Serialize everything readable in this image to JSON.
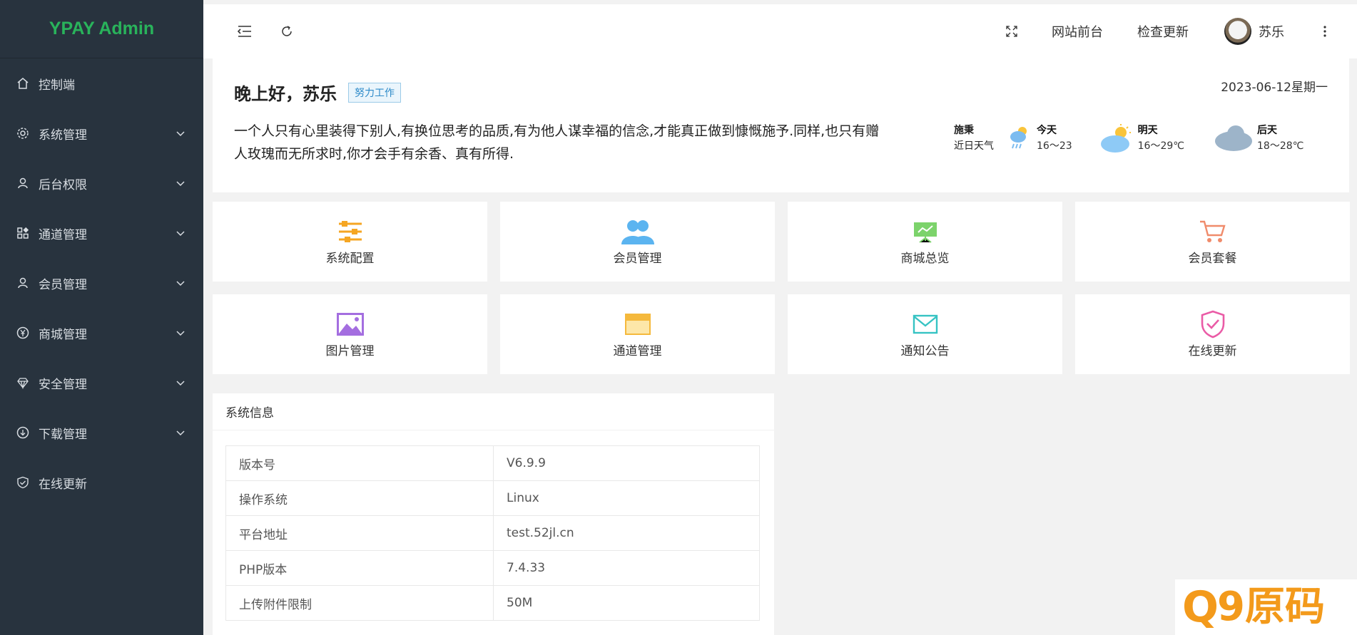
{
  "app": {
    "logo": "YPAY Admin"
  },
  "sidebar": {
    "items": [
      {
        "label": "控制端",
        "icon": "home-icon",
        "has_arrow": false
      },
      {
        "label": "系统管理",
        "icon": "gear-icon",
        "has_arrow": true
      },
      {
        "label": "后台权限",
        "icon": "user-icon",
        "has_arrow": true
      },
      {
        "label": "通道管理",
        "icon": "apps-icon",
        "has_arrow": true
      },
      {
        "label": "会员管理",
        "icon": "user-icon",
        "has_arrow": true
      },
      {
        "label": "商城管理",
        "icon": "yen-icon",
        "has_arrow": true
      },
      {
        "label": "安全管理",
        "icon": "diamond-icon",
        "has_arrow": true
      },
      {
        "label": "下载管理",
        "icon": "download-icon",
        "has_arrow": true
      },
      {
        "label": "在线更新",
        "icon": "shield-check-icon",
        "has_arrow": false
      }
    ]
  },
  "header": {
    "frontend_link": "网站前台",
    "check_update": "检查更新",
    "username": "苏乐"
  },
  "welcome": {
    "greeting": "晚上好，苏乐",
    "badge": "努力工作",
    "date": "2023-06-12星期一",
    "quote": "一个人只有心里装得下别人,有换位思考的品质,有为他人谋幸福的信念,才能真正做到慷慨施予.同样,也只有赠人玫瑰而无所求时,你才会手有余香、真有所得."
  },
  "weather": {
    "city": "施秉",
    "caption": "近日天气",
    "days": [
      {
        "label": "今天",
        "temp": "16～23",
        "icon": "rain-cloud-icon"
      },
      {
        "label": "明天",
        "temp": "16～29℃",
        "icon": "sun-cloud-icon"
      },
      {
        "label": "后天",
        "temp": "18～28℃",
        "icon": "cloud-icon"
      }
    ]
  },
  "quick": [
    {
      "label": "系统配置",
      "icon": "sliders-icon",
      "color": "#f5a623"
    },
    {
      "label": "会员管理",
      "icon": "users-icon",
      "color": "#5bb4f0"
    },
    {
      "label": "商城总览",
      "icon": "board-chart-icon",
      "color": "#7cd36b"
    },
    {
      "label": "会员套餐",
      "icon": "cart-icon",
      "color": "#f08b6b"
    },
    {
      "label": "图片管理",
      "icon": "image-icon",
      "color": "#a46ee0"
    },
    {
      "label": "通道管理",
      "icon": "window-icon",
      "color": "#f5b93c"
    },
    {
      "label": "通知公告",
      "icon": "mail-icon",
      "color": "#36c3c3"
    },
    {
      "label": "在线更新",
      "icon": "shield-check-icon",
      "color": "#ea5ba6"
    }
  ],
  "sysinfo": {
    "title": "系统信息",
    "rows": [
      {
        "key": "版本号",
        "value": "V6.9.9"
      },
      {
        "key": "操作系统",
        "value": "Linux"
      },
      {
        "key": "平台地址",
        "value": "test.52jl.cn"
      },
      {
        "key": "PHP版本",
        "value": "7.4.33"
      },
      {
        "key": "上传附件限制",
        "value": "50M"
      }
    ]
  },
  "watermark": {
    "text": "9原码"
  }
}
